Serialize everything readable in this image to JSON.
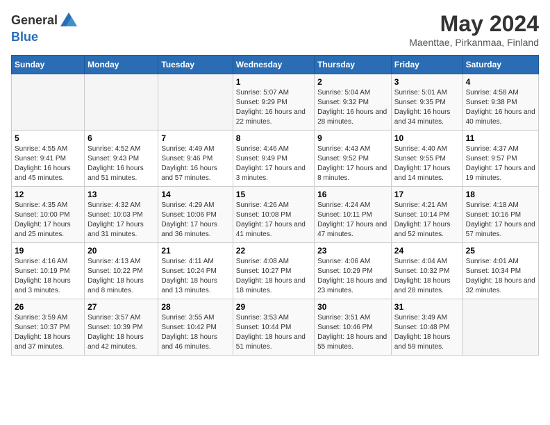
{
  "header": {
    "logo_general": "General",
    "logo_blue": "Blue",
    "main_title": "May 2024",
    "subtitle": "Maenttae, Pirkanmaa, Finland"
  },
  "days_of_week": [
    "Sunday",
    "Monday",
    "Tuesday",
    "Wednesday",
    "Thursday",
    "Friday",
    "Saturday"
  ],
  "weeks": [
    [
      {
        "num": "",
        "sunrise": "",
        "sunset": "",
        "daylight": ""
      },
      {
        "num": "",
        "sunrise": "",
        "sunset": "",
        "daylight": ""
      },
      {
        "num": "",
        "sunrise": "",
        "sunset": "",
        "daylight": ""
      },
      {
        "num": "1",
        "sunrise": "Sunrise: 5:07 AM",
        "sunset": "Sunset: 9:29 PM",
        "daylight": "Daylight: 16 hours and 22 minutes."
      },
      {
        "num": "2",
        "sunrise": "Sunrise: 5:04 AM",
        "sunset": "Sunset: 9:32 PM",
        "daylight": "Daylight: 16 hours and 28 minutes."
      },
      {
        "num": "3",
        "sunrise": "Sunrise: 5:01 AM",
        "sunset": "Sunset: 9:35 PM",
        "daylight": "Daylight: 16 hours and 34 minutes."
      },
      {
        "num": "4",
        "sunrise": "Sunrise: 4:58 AM",
        "sunset": "Sunset: 9:38 PM",
        "daylight": "Daylight: 16 hours and 40 minutes."
      }
    ],
    [
      {
        "num": "5",
        "sunrise": "Sunrise: 4:55 AM",
        "sunset": "Sunset: 9:41 PM",
        "daylight": "Daylight: 16 hours and 45 minutes."
      },
      {
        "num": "6",
        "sunrise": "Sunrise: 4:52 AM",
        "sunset": "Sunset: 9:43 PM",
        "daylight": "Daylight: 16 hours and 51 minutes."
      },
      {
        "num": "7",
        "sunrise": "Sunrise: 4:49 AM",
        "sunset": "Sunset: 9:46 PM",
        "daylight": "Daylight: 16 hours and 57 minutes."
      },
      {
        "num": "8",
        "sunrise": "Sunrise: 4:46 AM",
        "sunset": "Sunset: 9:49 PM",
        "daylight": "Daylight: 17 hours and 3 minutes."
      },
      {
        "num": "9",
        "sunrise": "Sunrise: 4:43 AM",
        "sunset": "Sunset: 9:52 PM",
        "daylight": "Daylight: 17 hours and 8 minutes."
      },
      {
        "num": "10",
        "sunrise": "Sunrise: 4:40 AM",
        "sunset": "Sunset: 9:55 PM",
        "daylight": "Daylight: 17 hours and 14 minutes."
      },
      {
        "num": "11",
        "sunrise": "Sunrise: 4:37 AM",
        "sunset": "Sunset: 9:57 PM",
        "daylight": "Daylight: 17 hours and 19 minutes."
      }
    ],
    [
      {
        "num": "12",
        "sunrise": "Sunrise: 4:35 AM",
        "sunset": "Sunset: 10:00 PM",
        "daylight": "Daylight: 17 hours and 25 minutes."
      },
      {
        "num": "13",
        "sunrise": "Sunrise: 4:32 AM",
        "sunset": "Sunset: 10:03 PM",
        "daylight": "Daylight: 17 hours and 31 minutes."
      },
      {
        "num": "14",
        "sunrise": "Sunrise: 4:29 AM",
        "sunset": "Sunset: 10:06 PM",
        "daylight": "Daylight: 17 hours and 36 minutes."
      },
      {
        "num": "15",
        "sunrise": "Sunrise: 4:26 AM",
        "sunset": "Sunset: 10:08 PM",
        "daylight": "Daylight: 17 hours and 41 minutes."
      },
      {
        "num": "16",
        "sunrise": "Sunrise: 4:24 AM",
        "sunset": "Sunset: 10:11 PM",
        "daylight": "Daylight: 17 hours and 47 minutes."
      },
      {
        "num": "17",
        "sunrise": "Sunrise: 4:21 AM",
        "sunset": "Sunset: 10:14 PM",
        "daylight": "Daylight: 17 hours and 52 minutes."
      },
      {
        "num": "18",
        "sunrise": "Sunrise: 4:18 AM",
        "sunset": "Sunset: 10:16 PM",
        "daylight": "Daylight: 17 hours and 57 minutes."
      }
    ],
    [
      {
        "num": "19",
        "sunrise": "Sunrise: 4:16 AM",
        "sunset": "Sunset: 10:19 PM",
        "daylight": "Daylight: 18 hours and 3 minutes."
      },
      {
        "num": "20",
        "sunrise": "Sunrise: 4:13 AM",
        "sunset": "Sunset: 10:22 PM",
        "daylight": "Daylight: 18 hours and 8 minutes."
      },
      {
        "num": "21",
        "sunrise": "Sunrise: 4:11 AM",
        "sunset": "Sunset: 10:24 PM",
        "daylight": "Daylight: 18 hours and 13 minutes."
      },
      {
        "num": "22",
        "sunrise": "Sunrise: 4:08 AM",
        "sunset": "Sunset: 10:27 PM",
        "daylight": "Daylight: 18 hours and 18 minutes."
      },
      {
        "num": "23",
        "sunrise": "Sunrise: 4:06 AM",
        "sunset": "Sunset: 10:29 PM",
        "daylight": "Daylight: 18 hours and 23 minutes."
      },
      {
        "num": "24",
        "sunrise": "Sunrise: 4:04 AM",
        "sunset": "Sunset: 10:32 PM",
        "daylight": "Daylight: 18 hours and 28 minutes."
      },
      {
        "num": "25",
        "sunrise": "Sunrise: 4:01 AM",
        "sunset": "Sunset: 10:34 PM",
        "daylight": "Daylight: 18 hours and 32 minutes."
      }
    ],
    [
      {
        "num": "26",
        "sunrise": "Sunrise: 3:59 AM",
        "sunset": "Sunset: 10:37 PM",
        "daylight": "Daylight: 18 hours and 37 minutes."
      },
      {
        "num": "27",
        "sunrise": "Sunrise: 3:57 AM",
        "sunset": "Sunset: 10:39 PM",
        "daylight": "Daylight: 18 hours and 42 minutes."
      },
      {
        "num": "28",
        "sunrise": "Sunrise: 3:55 AM",
        "sunset": "Sunset: 10:42 PM",
        "daylight": "Daylight: 18 hours and 46 minutes."
      },
      {
        "num": "29",
        "sunrise": "Sunrise: 3:53 AM",
        "sunset": "Sunset: 10:44 PM",
        "daylight": "Daylight: 18 hours and 51 minutes."
      },
      {
        "num": "30",
        "sunrise": "Sunrise: 3:51 AM",
        "sunset": "Sunset: 10:46 PM",
        "daylight": "Daylight: 18 hours and 55 minutes."
      },
      {
        "num": "31",
        "sunrise": "Sunrise: 3:49 AM",
        "sunset": "Sunset: 10:48 PM",
        "daylight": "Daylight: 18 hours and 59 minutes."
      },
      {
        "num": "",
        "sunrise": "",
        "sunset": "",
        "daylight": ""
      }
    ]
  ]
}
